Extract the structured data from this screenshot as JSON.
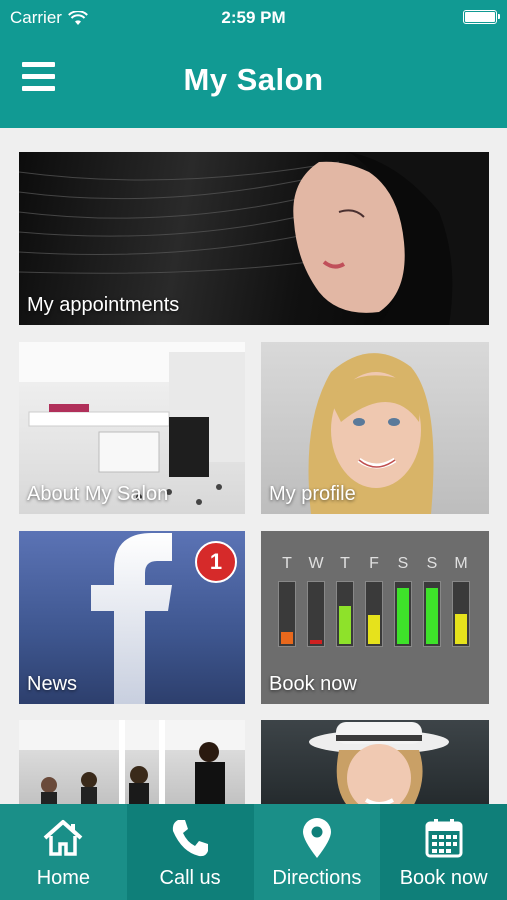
{
  "status_bar": {
    "carrier": "Carrier",
    "time": "2:59 PM"
  },
  "nav": {
    "title": "My Salon",
    "menu_icon": "hamburger-menu-icon"
  },
  "tiles": {
    "appointments": {
      "label": "My appointments"
    },
    "about": {
      "label": "About My Salon"
    },
    "profile": {
      "label": "My profile"
    },
    "news": {
      "label": "News",
      "badge": "1"
    },
    "book": {
      "label": "Book now",
      "days": [
        "T",
        "W",
        "T",
        "F",
        "S",
        "S",
        "M"
      ],
      "levels": [
        0.2,
        0.06,
        0.62,
        0.46,
        0.9,
        0.9,
        0.48
      ],
      "colors": [
        "#e8681c",
        "#d02020",
        "#8ee22a",
        "#e6e21c",
        "#3ee22a",
        "#3ee22a",
        "#e6e21c"
      ]
    }
  },
  "tabbar": [
    {
      "label": "Home",
      "icon": "home-icon"
    },
    {
      "label": "Call us",
      "icon": "phone-icon"
    },
    {
      "label": "Directions",
      "icon": "location-pin-icon"
    },
    {
      "label": "Book now",
      "icon": "calendar-icon"
    }
  ],
  "colors": {
    "brand": "#119a93",
    "badge": "#d62a2a"
  }
}
